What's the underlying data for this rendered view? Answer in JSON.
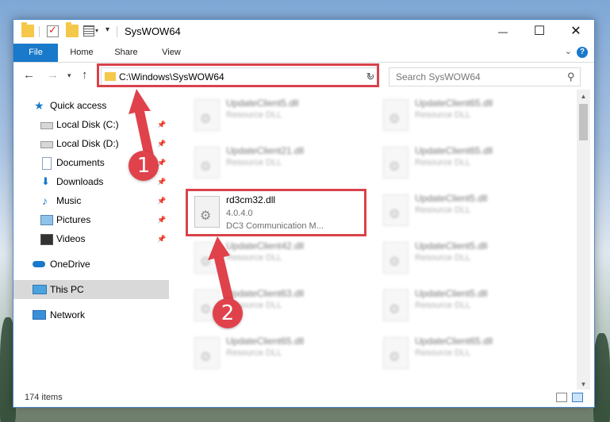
{
  "window": {
    "title": "SysWOW64",
    "minimize": "—",
    "maximize": "☐",
    "close": "✕"
  },
  "ribbon": {
    "tabs": [
      "File",
      "Home",
      "Share",
      "View"
    ],
    "help": "?",
    "expand": "⌄"
  },
  "address": {
    "path": "C:\\Windows\\SysWOW64",
    "search_placeholder": "Search SysWOW64"
  },
  "nav_pane": {
    "quick_access": "Quick access",
    "items": [
      "Local Disk (C:)",
      "Local Disk (D:)",
      "Documents",
      "Downloads",
      "Music",
      "Pictures",
      "Videos"
    ],
    "onedrive": "OneDrive",
    "this_pc": "This PC",
    "network": "Network"
  },
  "files": {
    "highlighted": {
      "name": "rd3cm32.dll",
      "version": "4.0.4.0",
      "description": "DC3 Communication M..."
    },
    "blurred_left": [
      {
        "name": "UpdateClient5.dll",
        "type": "Resource DLL"
      },
      {
        "name": "UpdateClient21.dll",
        "type": "Resource DLL"
      },
      {
        "name": "UpdateClient42.dll",
        "type": "Resource DLL"
      },
      {
        "name": "UpdateClient63.dll",
        "type": "Resource DLL"
      },
      {
        "name": "UpdateClient65.dll",
        "type": "Resource DLL"
      }
    ],
    "blurred_right": [
      {
        "name": "UpdateClient65.dll",
        "type": "Resource DLL"
      },
      {
        "name": "UpdateClient65.dll",
        "type": "Resource DLL"
      },
      {
        "name": "UpdateClient5.dll",
        "type": "Resource DLL"
      },
      {
        "name": "UpdateClient5.dll",
        "type": "Resource DLL"
      },
      {
        "name": "UpdateClient5.dll",
        "type": "Resource DLL"
      },
      {
        "name": "UpdateClient65.dll",
        "type": "Resource DLL"
      }
    ]
  },
  "status": {
    "item_count": "174 items"
  },
  "annotations": {
    "marker1": "1",
    "marker2": "2",
    "color": "#d9424a"
  }
}
